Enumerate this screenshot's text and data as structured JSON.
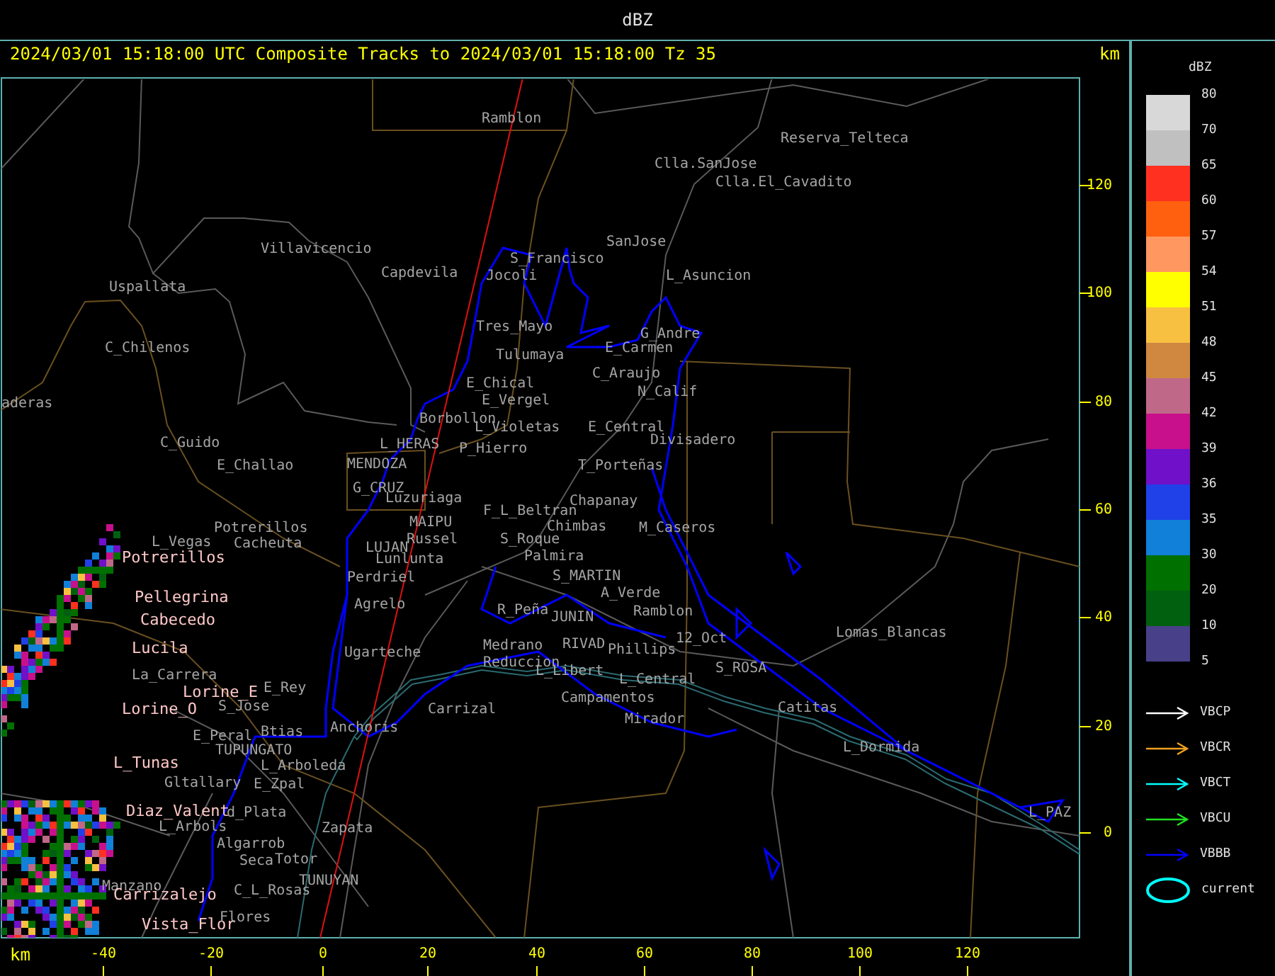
{
  "window": {
    "title": "dBZ"
  },
  "plot": {
    "caption": "2024/03/01 15:18:00 UTC Composite Tracks to 2024/03/01 15:18:00 Tz 35",
    "y_unit": "km",
    "x_unit": "km",
    "x_ticks": [
      "-40",
      "-20",
      "0",
      "20",
      "40",
      "60",
      "80",
      "100",
      "120"
    ],
    "y_ticks": [
      "120",
      "100",
      "80",
      "60",
      "40",
      "20",
      "0"
    ]
  },
  "places": [
    {
      "name": "Ramblon",
      "kind": "town"
    },
    {
      "name": "Reserva_Telteca",
      "kind": "town"
    },
    {
      "name": "Clla.SanJose",
      "kind": "town"
    },
    {
      "name": "Clla.El_Cavadito",
      "kind": "town"
    },
    {
      "name": "SanJose",
      "kind": "town"
    },
    {
      "name": "Villavicencio",
      "kind": "town"
    },
    {
      "name": "S_Francisco",
      "kind": "town"
    },
    {
      "name": "Capdevila",
      "kind": "town"
    },
    {
      "name": "Jocoli",
      "kind": "town"
    },
    {
      "name": "L_Asuncion",
      "kind": "town"
    },
    {
      "name": "Uspallata",
      "kind": "town"
    },
    {
      "name": "Tres_Mayo",
      "kind": "town"
    },
    {
      "name": "G_Andre",
      "kind": "town"
    },
    {
      "name": "C_Chilenos",
      "kind": "town"
    },
    {
      "name": "E_Carmen",
      "kind": "town"
    },
    {
      "name": "Tulumaya",
      "kind": "town"
    },
    {
      "name": "C_Araujo",
      "kind": "town"
    },
    {
      "name": "E_Chical",
      "kind": "town"
    },
    {
      "name": "N_Calif",
      "kind": "town"
    },
    {
      "name": "aderas",
      "kind": "town"
    },
    {
      "name": "E_Vergel",
      "kind": "town"
    },
    {
      "name": "Borbollon",
      "kind": "town"
    },
    {
      "name": "L_Violetas",
      "kind": "town"
    },
    {
      "name": "E_Central",
      "kind": "town"
    },
    {
      "name": "C_Guido",
      "kind": "town"
    },
    {
      "name": "L_HERAS",
      "kind": "town"
    },
    {
      "name": "P_Hierro",
      "kind": "town"
    },
    {
      "name": "Divisadero",
      "kind": "town"
    },
    {
      "name": "E_Challao",
      "kind": "town"
    },
    {
      "name": "MENDOZA",
      "kind": "town"
    },
    {
      "name": "T_Porteñas",
      "kind": "town"
    },
    {
      "name": "G_CRUZ",
      "kind": "town"
    },
    {
      "name": "Luzuriaga",
      "kind": "town"
    },
    {
      "name": "Chapanay",
      "kind": "town"
    },
    {
      "name": "F_L_Beltran",
      "kind": "town"
    },
    {
      "name": "Potrerillos",
      "kind": "town"
    },
    {
      "name": "MAIPU",
      "kind": "town"
    },
    {
      "name": "Chimbas",
      "kind": "town"
    },
    {
      "name": "M_Caseros",
      "kind": "town"
    },
    {
      "name": "L_Vegas",
      "kind": "town"
    },
    {
      "name": "Cacheuta",
      "kind": "town"
    },
    {
      "name": "Russel",
      "kind": "town"
    },
    {
      "name": "S_Roque",
      "kind": "town"
    },
    {
      "name": "LUJAN",
      "kind": "town"
    },
    {
      "name": "Potrerillos",
      "kind": "alert"
    },
    {
      "name": "Lunlunta",
      "kind": "town"
    },
    {
      "name": "Palmira",
      "kind": "town"
    },
    {
      "name": "Perdriel",
      "kind": "town"
    },
    {
      "name": "S_MARTIN",
      "kind": "town"
    },
    {
      "name": "Pellegrina",
      "kind": "alert"
    },
    {
      "name": "A_Verde",
      "kind": "town"
    },
    {
      "name": "Agrelo",
      "kind": "town"
    },
    {
      "name": "R_Peña",
      "kind": "town"
    },
    {
      "name": "Ramblon",
      "kind": "town"
    },
    {
      "name": "Cabecedo",
      "kind": "alert"
    },
    {
      "name": "JUNIN",
      "kind": "town"
    },
    {
      "name": "Lomas_Blancas",
      "kind": "town"
    },
    {
      "name": "12_Oct",
      "kind": "town"
    },
    {
      "name": "Lucila",
      "kind": "alert"
    },
    {
      "name": "Ugarteche",
      "kind": "town"
    },
    {
      "name": "Medrano",
      "kind": "town"
    },
    {
      "name": "RIVAD",
      "kind": "town"
    },
    {
      "name": "Phillips",
      "kind": "town"
    },
    {
      "name": "Reduccion",
      "kind": "town"
    },
    {
      "name": "La_Carrera",
      "kind": "town"
    },
    {
      "name": "L_Libert",
      "kind": "town"
    },
    {
      "name": "S_ROSA",
      "kind": "town"
    },
    {
      "name": "L_Central",
      "kind": "town"
    },
    {
      "name": "Lorine_E",
      "kind": "alert"
    },
    {
      "name": "E_Rey",
      "kind": "town"
    },
    {
      "name": "Campamentos",
      "kind": "town"
    },
    {
      "name": "Lorine_O",
      "kind": "alert"
    },
    {
      "name": "S_Jose",
      "kind": "town"
    },
    {
      "name": "Carrizal",
      "kind": "town"
    },
    {
      "name": "Catitas",
      "kind": "town"
    },
    {
      "name": "Mirador",
      "kind": "town"
    },
    {
      "name": "E_Peral",
      "kind": "town"
    },
    {
      "name": "Btias",
      "kind": "town"
    },
    {
      "name": "Anchoris",
      "kind": "town"
    },
    {
      "name": "TUPUNGATO",
      "kind": "town"
    },
    {
      "name": "L_Dormida",
      "kind": "town"
    },
    {
      "name": "L_Tunas",
      "kind": "alert"
    },
    {
      "name": "L_Arboleda",
      "kind": "town"
    },
    {
      "name": "Gltallary",
      "kind": "town"
    },
    {
      "name": "E_Zpal",
      "kind": "town"
    },
    {
      "name": "Diaz_Valent",
      "kind": "alert"
    },
    {
      "name": "d_Plata",
      "kind": "town"
    },
    {
      "name": "L_PAZ",
      "kind": "town"
    },
    {
      "name": "L_Arbols",
      "kind": "town"
    },
    {
      "name": "Zapata",
      "kind": "town"
    },
    {
      "name": "Algarrob",
      "kind": "town"
    },
    {
      "name": "Seca",
      "kind": "town"
    },
    {
      "name": "Totor",
      "kind": "town"
    },
    {
      "name": "Manzano",
      "kind": "town"
    },
    {
      "name": "Carrizalejo",
      "kind": "alert"
    },
    {
      "name": "C_L_Rosas",
      "kind": "town"
    },
    {
      "name": "TUNUYAN",
      "kind": "town"
    },
    {
      "name": "Vista_Flor",
      "kind": "alert"
    },
    {
      "name": "Flores",
      "kind": "town"
    }
  ],
  "legend": {
    "title": "dBZ",
    "swatches": [
      {
        "color": "#d8d8d8"
      },
      {
        "color": "#c0c0c0"
      },
      {
        "color": "#ff3020"
      },
      {
        "color": "#ff6010"
      },
      {
        "color": "#ff9860"
      },
      {
        "color": "#ffff00"
      },
      {
        "color": "#f8c040"
      },
      {
        "color": "#d08840"
      },
      {
        "color": "#c06888"
      },
      {
        "color": "#c8108c"
      },
      {
        "color": "#7010c8"
      },
      {
        "color": "#2040e8"
      },
      {
        "color": "#1080d8"
      },
      {
        "color": "#007000"
      },
      {
        "color": "#006010"
      },
      {
        "color": "#484088"
      }
    ],
    "levels": [
      "80",
      "70",
      "65",
      "60",
      "57",
      "54",
      "51",
      "48",
      "45",
      "42",
      "39",
      "36",
      "35",
      "30",
      "20",
      "10",
      "5"
    ],
    "tracks": [
      {
        "label": "VBCP",
        "kind": "arrow",
        "color": "#ffffff"
      },
      {
        "label": "VBCR",
        "kind": "arrow",
        "color": "#f0a020"
      },
      {
        "label": "VBCT",
        "kind": "arrow",
        "color": "#00ffff"
      },
      {
        "label": "VBCU",
        "kind": "arrow",
        "color": "#20e020"
      },
      {
        "label": "VBBB",
        "kind": "arrow",
        "color": "#0000ff"
      },
      {
        "label": "current",
        "kind": "ellipse",
        "color": "#00ffff"
      }
    ]
  }
}
